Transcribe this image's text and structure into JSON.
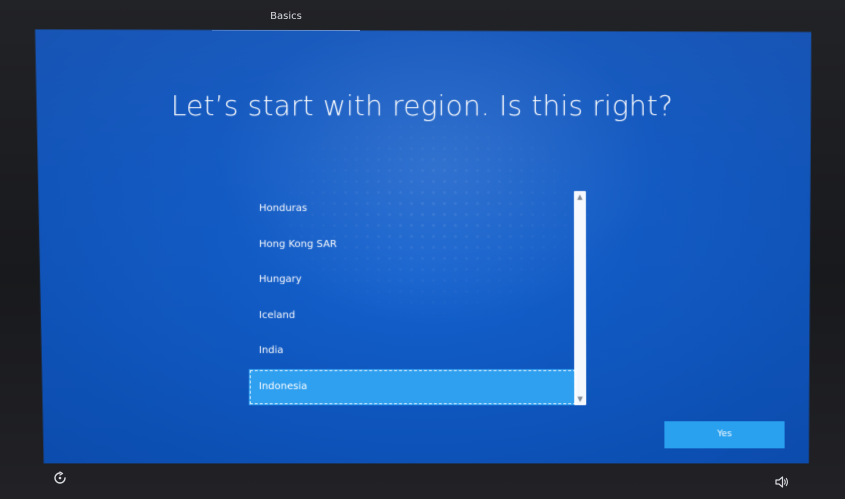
{
  "header": {
    "tab_label": "Basics"
  },
  "main": {
    "title": "Let’s start with region. Is this right?",
    "regions": [
      {
        "label": "Honduras",
        "selected": false
      },
      {
        "label": "Hong Kong SAR",
        "selected": false
      },
      {
        "label": "Hungary",
        "selected": false
      },
      {
        "label": "Iceland",
        "selected": false
      },
      {
        "label": "India",
        "selected": false
      },
      {
        "label": "Indonesia",
        "selected": true
      }
    ],
    "yes_button_label": "Yes"
  },
  "footer": {
    "left_icon": "ease-of-access-icon",
    "right_icon": "volume-icon"
  },
  "colors": {
    "background_blue": "#1664d2",
    "selected_item": "#2f9ff0",
    "button_blue": "#2aa1ef"
  }
}
